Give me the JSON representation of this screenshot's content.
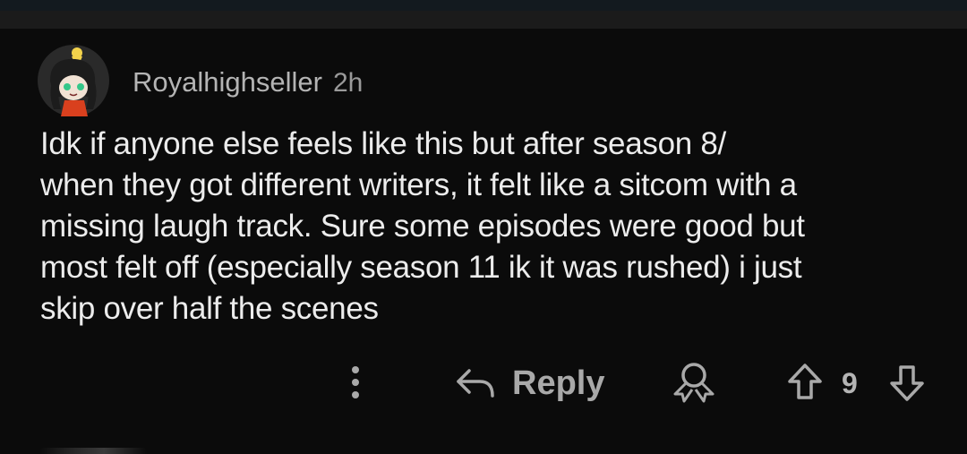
{
  "comment": {
    "author": "Royalhighseller",
    "age": "2h",
    "avatar_icon": "avatar-character-icon",
    "body_lines": [
      "Idk if anyone else feels like this but after season 8/",
      "when they got different writers, it felt like a sitcom with a",
      "missing laugh track. Sure some episodes were good but",
      "most felt off (especially season 11 ik it was rushed) i just",
      "skip over half the scenes"
    ]
  },
  "actions": {
    "more_icon": "more-vertical-icon",
    "reply_label": "Reply",
    "reply_icon": "reply-arrow-icon",
    "award_icon": "award-icon",
    "upvote_icon": "upvote-arrow-icon",
    "vote_count": "9",
    "downvote_icon": "downvote-arrow-icon"
  },
  "colors": {
    "background": "#0b0b0b",
    "text_primary": "#ececec",
    "text_secondary": "#b4b4b4"
  }
}
